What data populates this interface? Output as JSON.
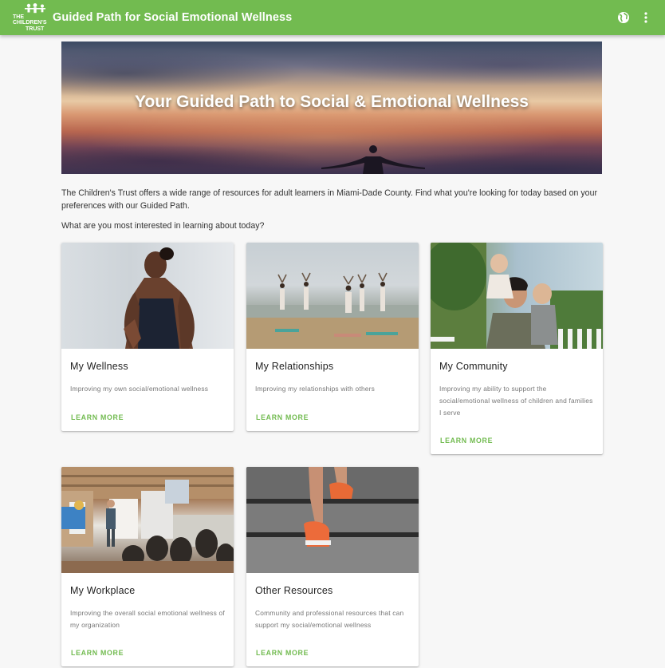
{
  "appbar": {
    "logo_text": "THE CHILDREN'S TRUST",
    "title": "Guided Path for Social Emotional Wellness",
    "language_icon": "globe-icon",
    "menu_icon": "more-vert-icon",
    "color": "#72bb50"
  },
  "hero": {
    "title": "Your Guided Path to Social & Emotional Wellness"
  },
  "intro": {
    "text": "The Children's Trust offers a wide range of resources for adult learners in Miami-Dade County. Find what you're looking for today based on your preferences with our Guided Path.",
    "question": "What are you most interested in learning about today?"
  },
  "cards": [
    {
      "title": "My Wellness",
      "description": "Improving my own social/emotional wellness",
      "link": "LEARN MORE"
    },
    {
      "title": "My Relationships",
      "description": "Improving my relationships with others",
      "link": "LEARN MORE"
    },
    {
      "title": "My Community",
      "description": "Improving my ability to support the social/emotional wellness of children and families I serve",
      "link": "LEARN MORE"
    },
    {
      "title": "My Workplace",
      "description": "Improving the overall social emotional wellness of my organization",
      "link": "LEARN MORE"
    },
    {
      "title": "Other Resources",
      "description": "Community and professional resources that can support my social/emotional wellness",
      "link": "LEARN MORE"
    }
  ],
  "accent_color": "#72bb50"
}
